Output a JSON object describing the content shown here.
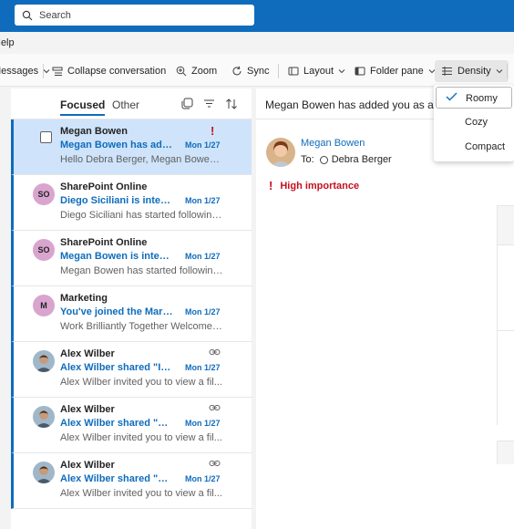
{
  "search": {
    "placeholder": "Search"
  },
  "menubar": {
    "help_label": "Help"
  },
  "ribbon": {
    "messages_label": "Messages",
    "collapse_label": "Collapse conversation",
    "zoom_label": "Zoom",
    "sync_label": "Sync",
    "layout_label": "Layout",
    "folder_pane_label": "Folder pane",
    "density_label": "Density"
  },
  "density_menu": {
    "options": [
      "Roomy",
      "Cozy",
      "Compact"
    ],
    "selected": "Roomy"
  },
  "list": {
    "tabs": {
      "focused": "Focused",
      "other": "Other"
    },
    "messages": [
      {
        "sender": "Megan Bowen",
        "subject": "Megan Bowen has added you as a member",
        "date": "Mon 1/27",
        "preview": "Hello Debra Berger, Megan Bowen i...",
        "important": true,
        "selected": true
      },
      {
        "sender": "SharePoint Online",
        "initials": "SO",
        "subject": "Diego Siciliani is interested in you",
        "date": "Mon 1/27",
        "preview": "Diego Siciliani has started following ..."
      },
      {
        "sender": "SharePoint Online",
        "initials": "SO",
        "subject": "Megan Bowen is interested in you",
        "date": "Mon 1/27",
        "preview": "Megan Bowen has started following..."
      },
      {
        "sender": "Marketing",
        "initials": "M",
        "subject": "You've joined the Marketing group",
        "date": "Mon 1/27",
        "preview": "Work Brilliantly Together Welcome t..."
      },
      {
        "sender": "Alex Wilber",
        "subject": "Alex Wilber shared \"Incident\"",
        "date": "Mon 1/27",
        "preview": "Alex Wilber invited you to view a fil...",
        "has_link": true
      },
      {
        "sender": "Alex Wilber",
        "subject": "Alex Wilber shared \"Ad Campaign\"",
        "date": "Mon 1/27",
        "preview": "Alex Wilber invited you to view a fil...",
        "has_link": true
      },
      {
        "sender": "Alex Wilber",
        "subject": "Alex Wilber shared \"Ad Budget\"",
        "date": "Mon 1/27",
        "preview": "Alex Wilber invited you to view a fil...",
        "has_link": true
      }
    ]
  },
  "reading": {
    "title": "Megan Bowen has added you as a member",
    "sender": "Megan Bowen",
    "to_label": "To:",
    "recipient": "Debra Berger",
    "importance": "High importance"
  },
  "colors": {
    "accent": "#0f6cbd",
    "important": "#c50f1f",
    "avatar_so": "#d9a5cf",
    "avatar_m": "#d9a5cf"
  }
}
